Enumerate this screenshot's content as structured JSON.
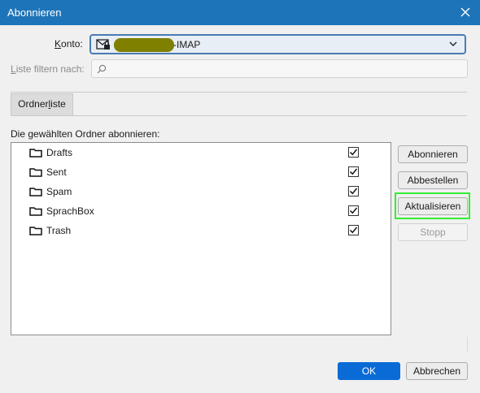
{
  "window": {
    "title": "Abonnieren",
    "close_icon": "close-icon"
  },
  "account": {
    "label": "Konto:",
    "value_suffix": "-IMAP",
    "icon": "mail-lock-icon"
  },
  "filter": {
    "label": "Liste filtern nach:",
    "placeholder": "",
    "icon": "search-icon"
  },
  "tabs": [
    {
      "label": "Ordnerliste"
    }
  ],
  "list_label": "Die gewählten Ordner abonnieren:",
  "folders": [
    {
      "name": "Drafts",
      "checked": true
    },
    {
      "name": "Sent",
      "checked": true
    },
    {
      "name": "Spam",
      "checked": true
    },
    {
      "name": "SprachBox",
      "checked": true
    },
    {
      "name": "Trash",
      "checked": true
    }
  ],
  "side_buttons": {
    "subscribe": "Abonnieren",
    "unsubscribe": "Abbestellen",
    "refresh": "Aktualisieren",
    "stop": "Stopp"
  },
  "footer": {
    "ok": "OK",
    "cancel": "Abbrechen"
  },
  "colors": {
    "titlebar": "#1e74b8",
    "highlight": "#33ee33",
    "primary": "#0b6bd6"
  }
}
